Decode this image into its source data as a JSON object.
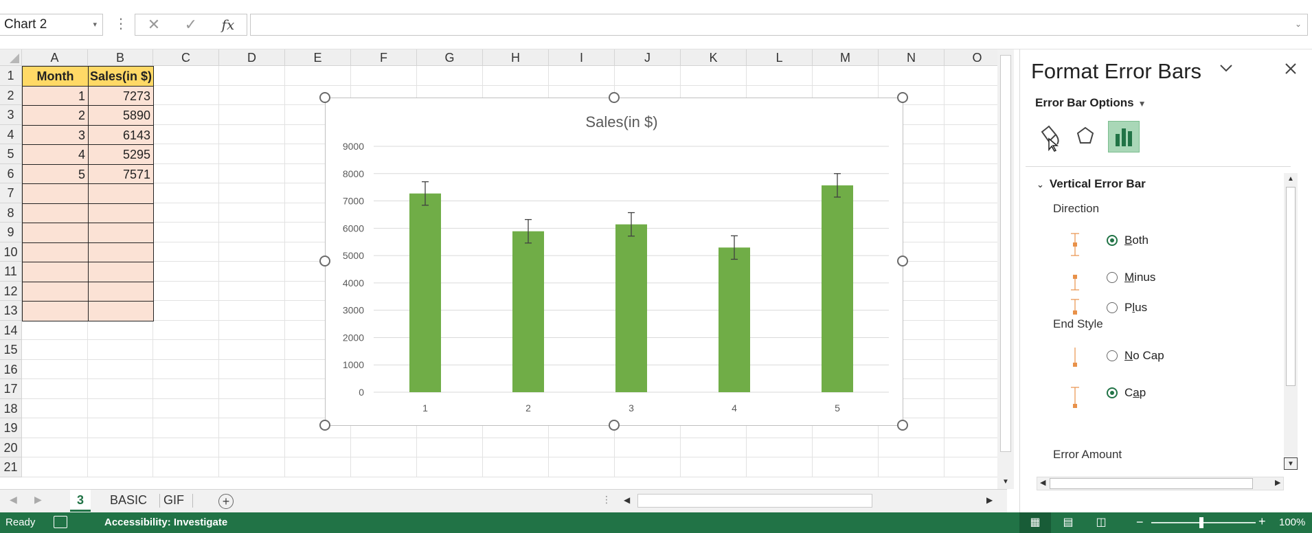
{
  "formula_bar": {
    "name_box": "Chart 2",
    "more": "⋮",
    "cancel": "✕",
    "enter": "✓",
    "fx": "fx",
    "formula": ""
  },
  "grid": {
    "columns": [
      "A",
      "B",
      "C",
      "D",
      "E",
      "F",
      "G",
      "H",
      "I",
      "J",
      "K",
      "L",
      "M",
      "N",
      "O"
    ],
    "rows": [
      "1",
      "2",
      "3",
      "4",
      "5",
      "6",
      "7",
      "8",
      "9",
      "10",
      "11",
      "12",
      "13",
      "14",
      "15",
      "16",
      "17",
      "18",
      "19",
      "20",
      "21"
    ],
    "table": {
      "headers": [
        "Month",
        "Sales(in $)"
      ],
      "rows": [
        [
          "1",
          "7273"
        ],
        [
          "2",
          "5890"
        ],
        [
          "3",
          "6143"
        ],
        [
          "4",
          "5295"
        ],
        [
          "5",
          "7571"
        ],
        [
          "",
          ""
        ],
        [
          "",
          ""
        ],
        [
          "",
          ""
        ],
        [
          "",
          ""
        ],
        [
          "",
          ""
        ],
        [
          "",
          ""
        ],
        [
          "",
          ""
        ]
      ]
    }
  },
  "chart_data": {
    "type": "bar",
    "title": "Sales(in $)",
    "categories": [
      "1",
      "2",
      "3",
      "4",
      "5"
    ],
    "values": [
      7273,
      5890,
      6143,
      5295,
      7571
    ],
    "error_bars": {
      "direction": "both",
      "end_style": "cap",
      "amount": [
        430,
        430,
        430,
        430,
        430
      ]
    },
    "ylim": [
      0,
      9000
    ],
    "yticks": [
      "0",
      "1000",
      "2000",
      "3000",
      "4000",
      "5000",
      "6000",
      "7000",
      "8000",
      "9000"
    ],
    "xlabel": "",
    "ylabel": "",
    "grid": true,
    "legend": false,
    "bar_color": "#70ad47"
  },
  "sheet_tabs": {
    "tabs": [
      "3",
      "BASIC",
      "GIF"
    ],
    "active": "3",
    "add": "+"
  },
  "pane": {
    "title": "Format Error Bars",
    "options_label": "Error Bar Options",
    "icons": [
      "fill-line-icon",
      "effects-icon",
      "bar-options-icon"
    ],
    "section": "Vertical Error Bar",
    "direction_label": "Direction",
    "direction": {
      "both": {
        "pre": "",
        "u": "B",
        "post": "oth"
      },
      "minus": {
        "pre": "",
        "u": "M",
        "post": "inus"
      },
      "plus": {
        "pre": "P",
        "u": "l",
        "post": "us"
      }
    },
    "end_style_label": "End Style",
    "end_style": {
      "no_cap": {
        "pre": "",
        "u": "N",
        "post": "o Cap"
      },
      "cap": {
        "pre": "C",
        "u": "a",
        "post": "p"
      }
    },
    "error_amount_label": "Error Amount",
    "selected_direction": "Both",
    "selected_end_style": "Cap"
  },
  "status": {
    "ready": "Ready",
    "accessibility": "Accessibility: Investigate",
    "zoom": "100%",
    "zoom_minus": "−",
    "zoom_plus": "+"
  },
  "colors": {
    "excel_green": "#217346",
    "header_fill": "#ffd966",
    "body_fill": "#fbe2d5",
    "bar": "#70ad47",
    "error_marker": "#e8914a"
  }
}
